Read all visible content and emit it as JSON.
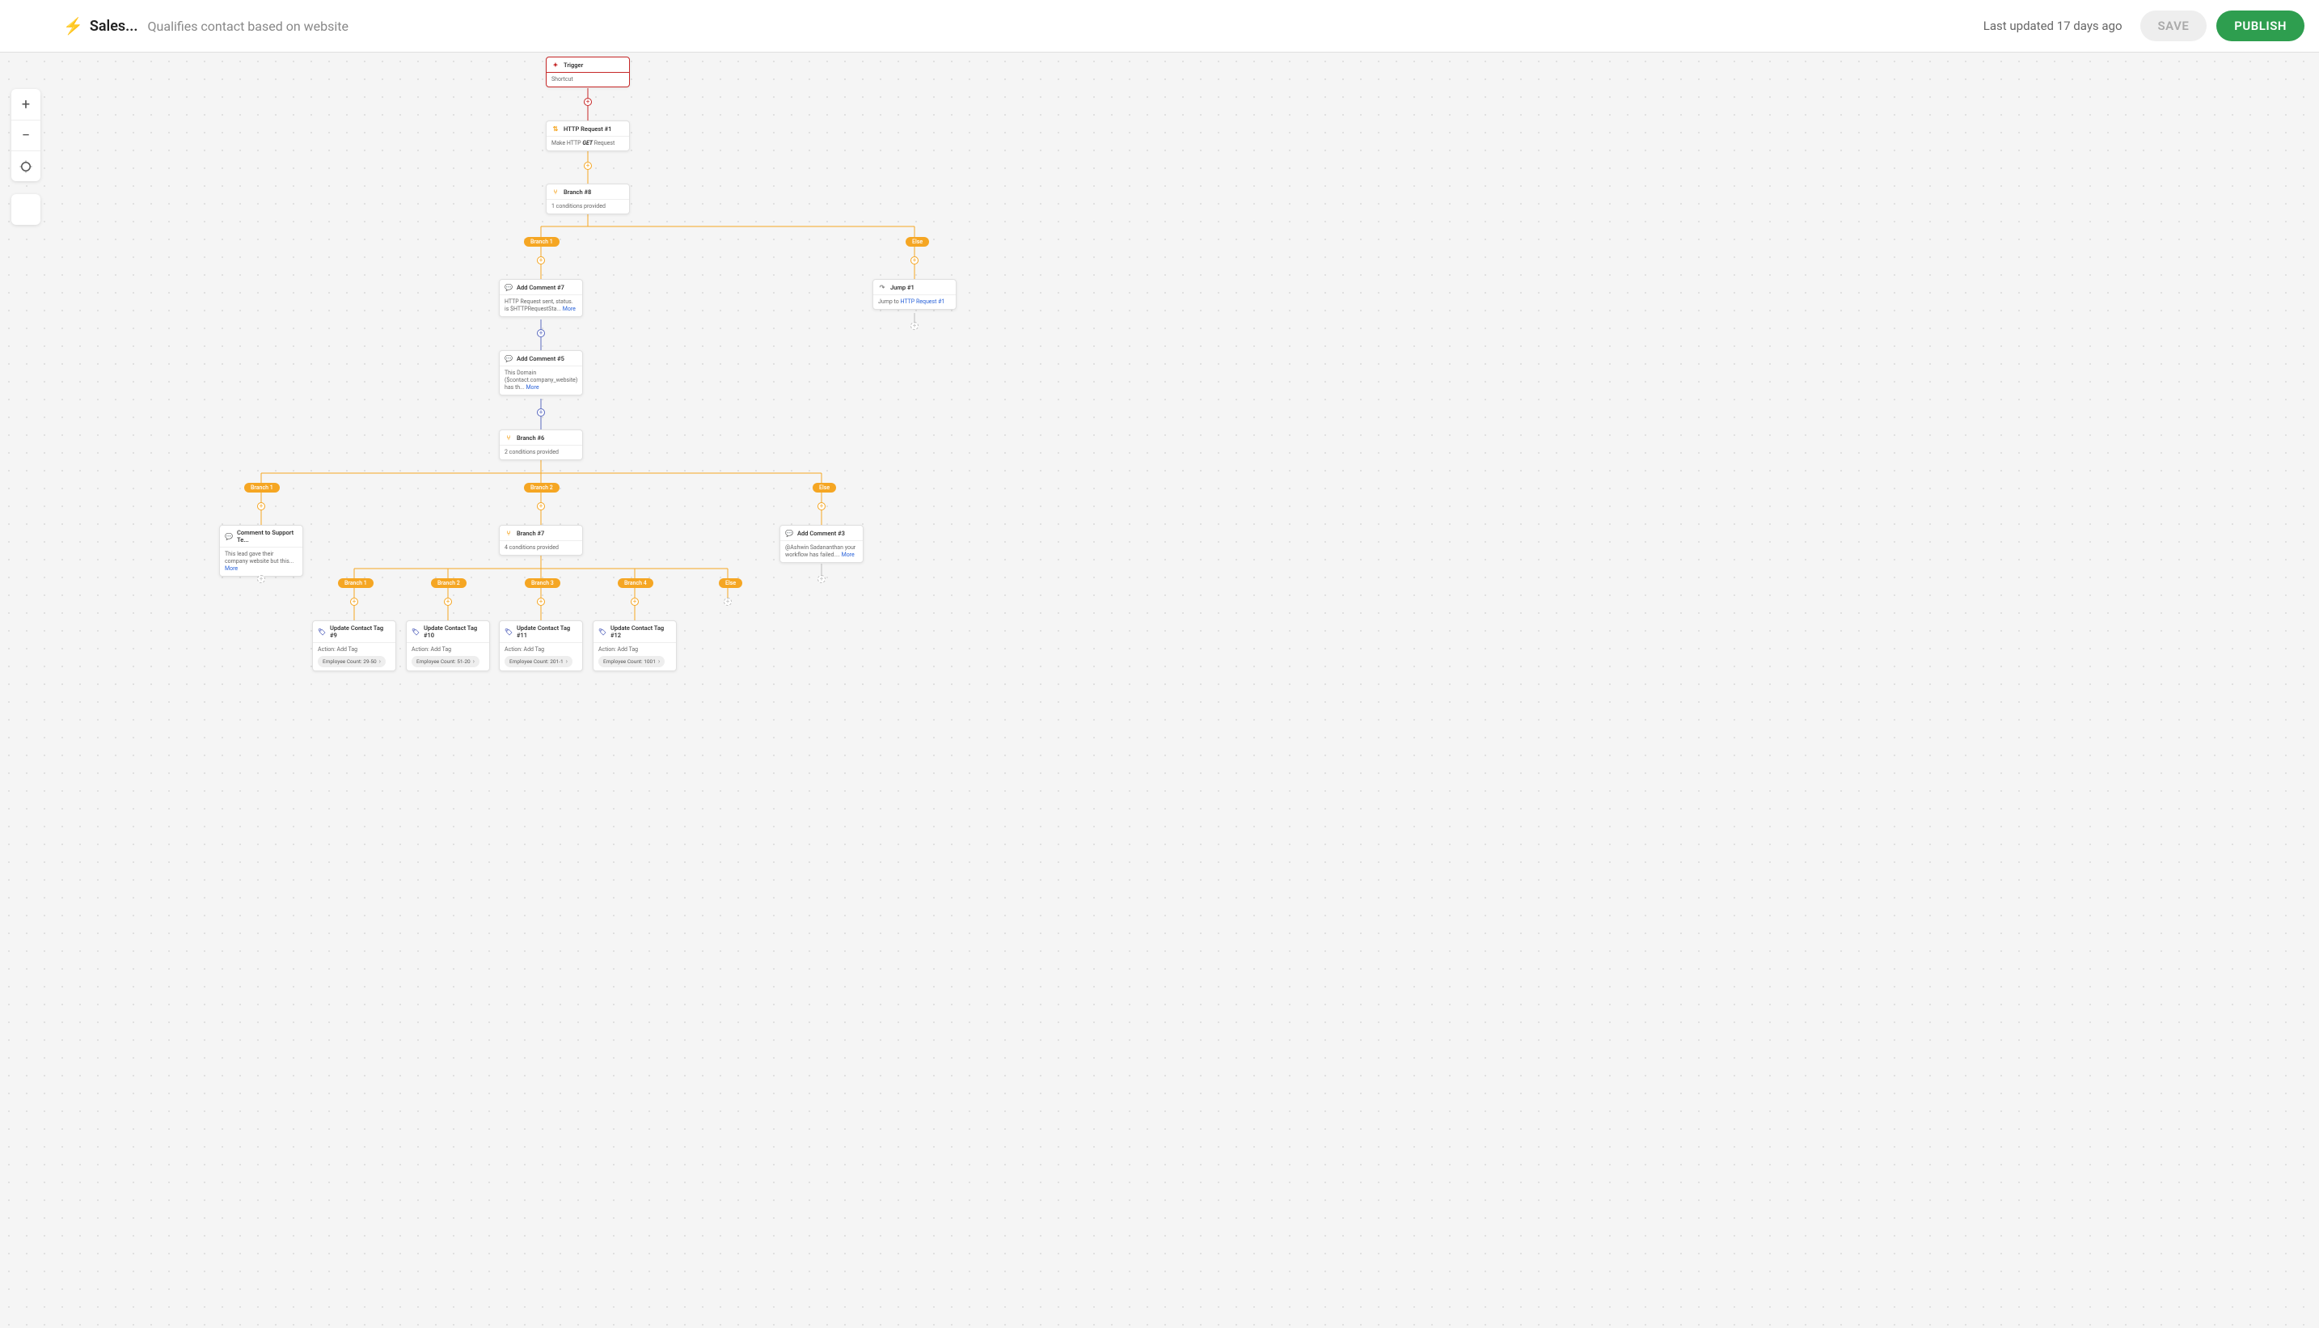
{
  "header": {
    "title": "Sales...",
    "subtitle": "Qualifies contact based on website",
    "last_updated": "Last updated 17 days ago",
    "save_label": "SAVE",
    "publish_label": "PUBLISH"
  },
  "nodes": {
    "trigger": {
      "title": "Trigger",
      "body": "Shortcut"
    },
    "http1": {
      "title": "HTTP Request #1",
      "body_prefix": "Make HTTP ",
      "body_method": "GET",
      "body_suffix": " Request"
    },
    "branch8": {
      "title": "Branch #8",
      "body": "1 conditions provided"
    },
    "comment7": {
      "title": "Add Comment #7",
      "body": "HTTP Request sent, status. is $HTTPRequestSta... ",
      "more": "More"
    },
    "jump1": {
      "title": "Jump #1",
      "body_prefix": "Jump to ",
      "link": "HTTP Request #1"
    },
    "comment5": {
      "title": "Add Comment #5",
      "body": "This Domain ($contact.company_website) has th... ",
      "more": "More"
    },
    "branch6": {
      "title": "Branch #6",
      "body": "2 conditions provided"
    },
    "commentSupport": {
      "title": "Comment to Support Te...",
      "body": "This lead gave their company website but this... ",
      "more": "More"
    },
    "branch7": {
      "title": "Branch #7",
      "body": "4 conditions provided"
    },
    "comment3": {
      "title": "Add Comment #3",
      "body": "@Ashwin Sadananthan your workflow has failed.... ",
      "more": "More"
    },
    "tag9": {
      "title": "Update Contact Tag #9",
      "action": "Action: Add Tag",
      "chip": "Employee Count: 29-50"
    },
    "tag10": {
      "title": "Update Contact Tag #10",
      "action": "Action: Add Tag",
      "chip": "Employee Count: 51-20"
    },
    "tag11": {
      "title": "Update Contact Tag #11",
      "action": "Action: Add Tag",
      "chip": "Employee Count: 201-1"
    },
    "tag12": {
      "title": "Update Contact Tag #12",
      "action": "Action: Add Tag",
      "chip": "Employee Count: 1001"
    }
  },
  "pills": {
    "b8_1": "Branch 1",
    "b8_else": "Else",
    "b6_1": "Branch 1",
    "b6_2": "Branch 2",
    "b6_else": "Else",
    "b7_1": "Branch 1",
    "b7_2": "Branch 2",
    "b7_3": "Branch 3",
    "b7_4": "Branch 4",
    "b7_else": "Else"
  }
}
